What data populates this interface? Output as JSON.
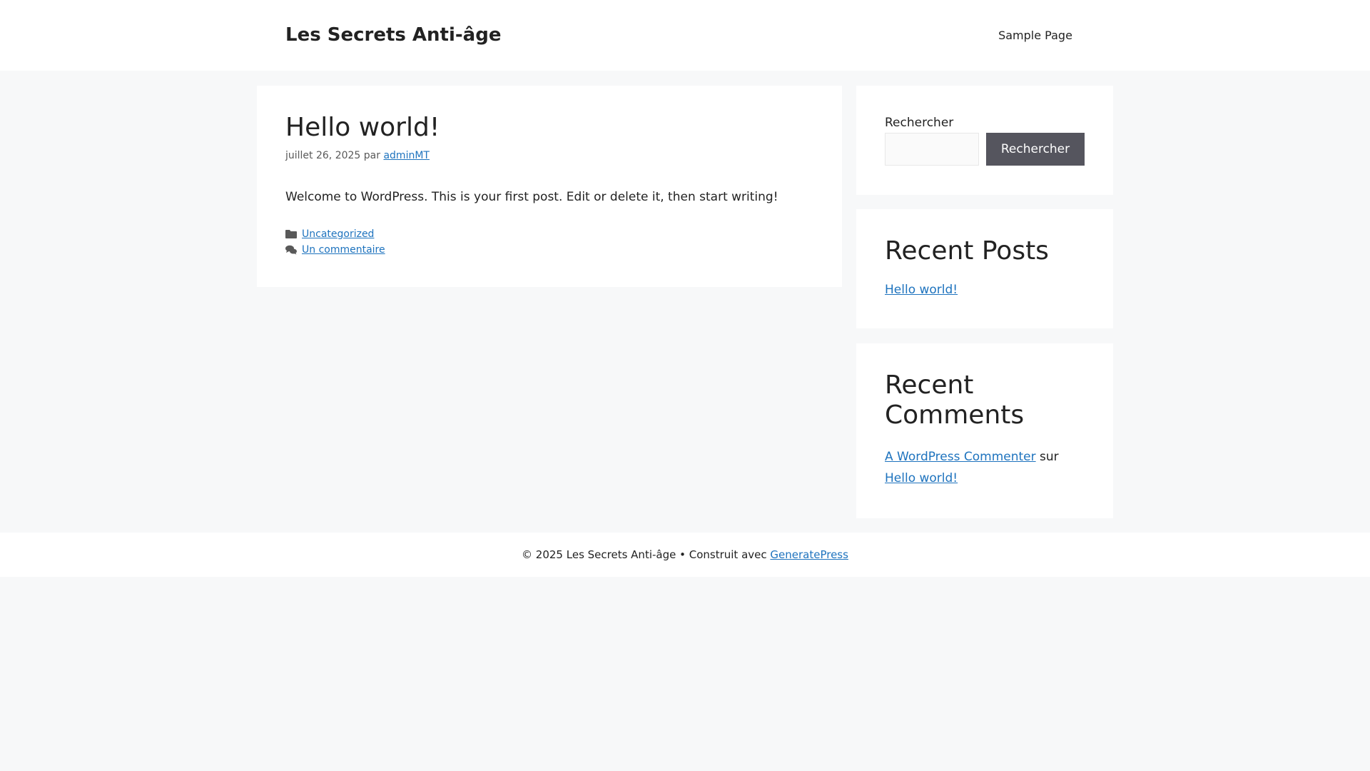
{
  "header": {
    "site_title": "Les Secrets Anti-âge",
    "nav_items": [
      "Sample Page"
    ]
  },
  "article": {
    "title": "Hello world!",
    "date": "juillet 26, 2025",
    "by_label": "par",
    "author": "adminMT",
    "content": "Welcome to WordPress. This is your first post. Edit or delete it, then start writing!",
    "category": "Uncategorized",
    "comments_link": "Un commentaire",
    "category_icon": "folder-icon",
    "comments_icon": "comments-icon"
  },
  "sidebar": {
    "search": {
      "label": "Rechercher",
      "input_value": "",
      "button_label": "Rechercher"
    },
    "recent_posts": {
      "title": "Recent Posts",
      "items": [
        "Hello world!"
      ]
    },
    "recent_comments": {
      "title": "Recent Comments",
      "items": [
        {
          "author": "A WordPress Commenter",
          "connector": "sur",
          "post": "Hello world!"
        }
      ]
    }
  },
  "footer": {
    "copyright": "© 2025 Les Secrets Anti-âge • Construit avec",
    "credit_link": "GeneratePress"
  },
  "colors": {
    "link": "#1e73be",
    "page_background": "#f7f8f9",
    "button_background": "#55555e",
    "text": "#222222"
  }
}
